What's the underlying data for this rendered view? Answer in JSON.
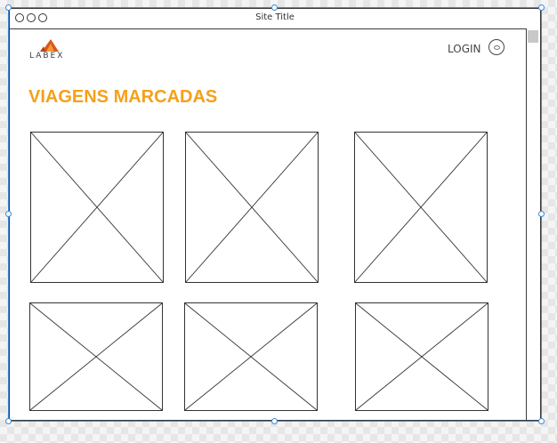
{
  "window": {
    "title": "Site Title"
  },
  "header": {
    "logo_text": "LABEX",
    "login_label": "LOGIN"
  },
  "main": {
    "heading": "VIAGENS MARCADAS"
  },
  "colors": {
    "accent": "#f5a01a",
    "selection": "#3c8ad8",
    "logo": "#d9581a"
  },
  "icons": {
    "avatar": "user-icon",
    "logo": "tent-logo-icon"
  }
}
